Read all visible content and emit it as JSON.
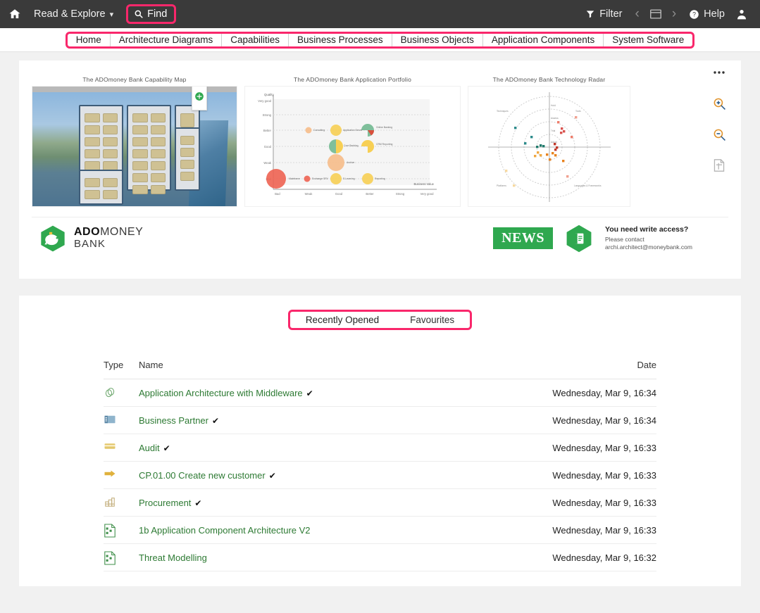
{
  "colors": {
    "highlight": "#f9276b",
    "topbar": "#3a3a3a",
    "brand_green": "#2fa84f",
    "link_green": "#2d7a33",
    "page_bg": "#f1f1f1"
  },
  "topbar": {
    "home_icon": "home-icon",
    "menu_label": "Read & Explore",
    "menu_caret": "∨",
    "find_label": "Find",
    "filter_label": "Filter",
    "help_label": "Help",
    "back_arrow": "‹",
    "forward_arrow": "›",
    "window_icon": "window-icon",
    "user_icon": "user-avatar-icon"
  },
  "tabs": [
    {
      "label": "Home"
    },
    {
      "label": "Architecture Diagrams"
    },
    {
      "label": "Capabilities"
    },
    {
      "label": "Business Processes"
    },
    {
      "label": "Business Objects"
    },
    {
      "label": "Application Components"
    },
    {
      "label": "System Software"
    }
  ],
  "side_tools": [
    {
      "name": "more-options-icon",
      "glyph": "•••"
    },
    {
      "name": "zoom-in-icon",
      "glyph": ""
    },
    {
      "name": "zoom-out-icon",
      "glyph": ""
    },
    {
      "name": "fit-page-icon",
      "glyph": ""
    }
  ],
  "thumbnails": [
    {
      "title": "The ADOmoney Bank Capability Map"
    },
    {
      "title": "The ADOmoney Bank Application Portfolio"
    },
    {
      "title": "The ADOmoney Bank Technology Radar"
    }
  ],
  "brand": {
    "line1_bold": "ADO",
    "line1_rest": "MONEY",
    "line2": "BANK",
    "logo_icon": "piggy-bank-hexagon-logo"
  },
  "news": {
    "badge": "NEWS",
    "icon": "document-hexagon-icon",
    "title": "You need write access?",
    "body": "Please contact archi.architect@moneybank.com"
  },
  "segmented": {
    "items": [
      {
        "label": "Recently Opened",
        "active": true
      },
      {
        "label": "Favourites",
        "active": false
      }
    ]
  },
  "recent_table": {
    "headers": {
      "type": "Type",
      "name": "Name",
      "date": "Date"
    },
    "rows": [
      {
        "icon": "rings-object-icon",
        "name": "Application Architecture with Middleware",
        "check": "✔",
        "date": "Wednesday, Mar 9, 16:34"
      },
      {
        "icon": "business-partner-icon",
        "name": "Business Partner",
        "check": "✔",
        "date": "Wednesday, Mar 9, 16:34"
      },
      {
        "icon": "card-audit-icon",
        "name": "Audit",
        "check": "✔",
        "date": "Wednesday, Mar 9, 16:33"
      },
      {
        "icon": "arrow-process-icon",
        "name": "CP.01.00 Create new customer",
        "check": "✔",
        "date": "Wednesday, Mar 9, 16:33"
      },
      {
        "icon": "capability-blocks-icon",
        "name": "Procurement",
        "check": "✔",
        "date": "Wednesday, Mar 9, 16:33"
      },
      {
        "icon": "diagram-page-icon",
        "name": "1b Application Component Architecture V2",
        "check": "",
        "date": "Wednesday, Mar 9, 16:33"
      },
      {
        "icon": "diagram-page-icon",
        "name": "Threat Modelling",
        "check": "",
        "date": "Wednesday, Mar 9, 16:32"
      }
    ]
  },
  "chart_data": [
    {
      "type": "scatter",
      "title": "The ADOmoney Bank Application Portfolio",
      "xlabel": "Business Value",
      "ylabel": "Quality",
      "xticks": [
        "Bad",
        "Weak",
        "Good",
        "Better",
        "Strong",
        "Very good"
      ],
      "yticks": [
        "Very good",
        "Strong",
        "Better",
        "Good",
        "Weak",
        "Bad"
      ],
      "points": [
        {
          "x": 0.02,
          "y": 0.06,
          "r": 20,
          "color": "#ee6352",
          "label": "Mainframe"
        },
        {
          "x": 0.22,
          "y": 0.06,
          "r": 6,
          "color": "#ee6352",
          "label": "Exchange SRV"
        },
        {
          "x": 0.42,
          "y": 0.06,
          "r": 11,
          "color": "#f7cf54",
          "label": "E-Learning"
        },
        {
          "x": 0.63,
          "y": 0.06,
          "r": 11,
          "color": "#f7cf54",
          "label": "Reporting"
        },
        {
          "x": 0.42,
          "y": 0.26,
          "r": 18,
          "color": "#f6bd8a",
          "label": "Archive"
        },
        {
          "x": 0.42,
          "y": 0.46,
          "r": 15,
          "color": "#7fbf9b",
          "label": "Core Banking"
        },
        {
          "x": 0.63,
          "y": 0.46,
          "r": 12,
          "color": "#f7cf54",
          "label": "CRM Reporting"
        },
        {
          "x": 0.25,
          "y": 0.66,
          "r": 6,
          "color": "#f6bd8a",
          "label": "Consulting"
        },
        {
          "x": 0.42,
          "y": 0.66,
          "r": 11,
          "color": "#f7cf54",
          "label": "Application Server"
        },
        {
          "x": 0.63,
          "y": 0.66,
          "r": 13,
          "color": "#7fbf9b",
          "label": "Online Banking"
        }
      ]
    },
    {
      "type": "scatter",
      "title": "The ADOmoney Bank Technology Radar",
      "quadrants": [
        "Techniques",
        "Tools",
        "Platforms",
        "Languages & Frameworks"
      ],
      "rings": [
        "Hold",
        "Assess",
        "Trial",
        "Adopt"
      ],
      "points": [
        {
          "x": -0.3,
          "y": 0.52,
          "color": "#2c8b8b"
        },
        {
          "x": -0.12,
          "y": 0.3,
          "color": "#2c8b8b"
        },
        {
          "x": -0.2,
          "y": 0.1,
          "color": "#2c8b8b"
        },
        {
          "x": -0.08,
          "y": 0.04,
          "color": "#1f7a6b"
        },
        {
          "x": -0.04,
          "y": 0.06,
          "color": "#1f7a6b"
        },
        {
          "x": -0.02,
          "y": 0.03,
          "color": "#1f7a6b"
        },
        {
          "x": 0.1,
          "y": 0.08,
          "color": "#c0392b"
        },
        {
          "x": 0.14,
          "y": 0.05,
          "color": "#c0392b"
        },
        {
          "x": 0.12,
          "y": 0.0,
          "color": "#c0392b"
        },
        {
          "x": 0.2,
          "y": 0.3,
          "color": "#d9534f"
        },
        {
          "x": 0.26,
          "y": 0.34,
          "color": "#d9534f"
        },
        {
          "x": 0.24,
          "y": 0.4,
          "color": "#d9534f"
        },
        {
          "x": 0.16,
          "y": 0.5,
          "color": "#ef7d6b"
        },
        {
          "x": 0.4,
          "y": 0.24,
          "color": "#ef7d6b"
        },
        {
          "x": 0.55,
          "y": 0.62,
          "color": "#f1a08f"
        },
        {
          "x": -0.1,
          "y": -0.08,
          "color": "#f0a741"
        },
        {
          "x": -0.14,
          "y": -0.14,
          "color": "#f0a741"
        },
        {
          "x": -0.06,
          "y": -0.12,
          "color": "#f0a741"
        },
        {
          "x": 0.06,
          "y": -0.1,
          "color": "#e8821e"
        },
        {
          "x": 0.14,
          "y": -0.08,
          "color": "#e8821e"
        },
        {
          "x": 0.18,
          "y": -0.12,
          "color": "#e8821e"
        },
        {
          "x": 0.1,
          "y": -0.2,
          "color": "#e8821e"
        },
        {
          "x": 0.32,
          "y": -0.22,
          "color": "#e8821e"
        },
        {
          "x": -0.52,
          "y": -0.4,
          "color": "#f7d9a0"
        },
        {
          "x": -0.38,
          "y": -0.66,
          "color": "#f7d9a0"
        },
        {
          "x": 0.38,
          "y": -0.52,
          "color": "#f1a08f"
        }
      ]
    }
  ]
}
